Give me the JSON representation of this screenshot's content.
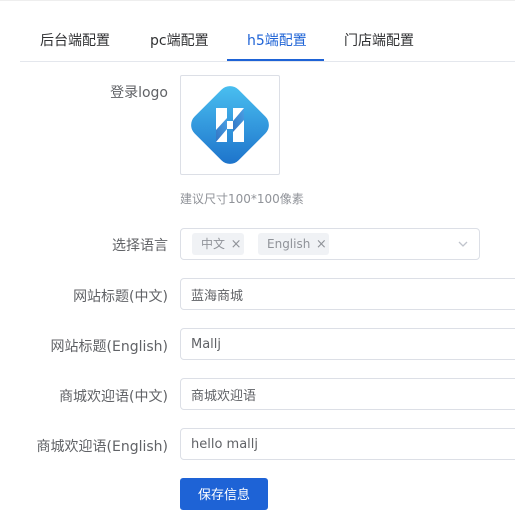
{
  "tabs": [
    {
      "label": "后台端配置"
    },
    {
      "label": "pc端配置"
    },
    {
      "label": "h5端配置"
    },
    {
      "label": "门店端配置"
    }
  ],
  "active_tab": "h5端配置",
  "form": {
    "logo_label": "登录logo",
    "logo_hint": "建议尺寸100*100像素",
    "language_label": "选择语言",
    "language_tags": [
      "中文",
      "English"
    ],
    "title_cn_label": "网站标题(中文)",
    "title_cn_value": "蓝海商城",
    "title_en_label": "网站标题(English)",
    "title_en_value": "Mallj",
    "welcome_cn_label": "商城欢迎语(中文)",
    "welcome_cn_value": "商城欢迎语",
    "welcome_en_label": "商城欢迎语(English)",
    "welcome_en_value": "hello mallj",
    "save_label": "保存信息"
  },
  "colors": {
    "accent": "#1e63d6",
    "logo_light": "#3fb6ee",
    "logo_dark": "#1468c4"
  },
  "icons": {
    "tag_close": "close-icon",
    "select_caret": "chevron-down-icon",
    "logo": "logo-image"
  }
}
